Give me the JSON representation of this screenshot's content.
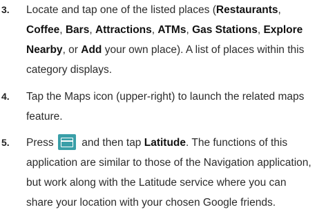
{
  "steps": [
    {
      "number": "3.",
      "lines": [
        [
          {
            "t": "Locate and tap one of the listed places (",
            "b": false
          },
          {
            "t": "Restaurants",
            "b": true
          },
          {
            "t": ",",
            "b": false
          }
        ],
        [
          {
            "t": "Coffee",
            "b": true
          },
          {
            "t": ", ",
            "b": false
          },
          {
            "t": "Bars",
            "b": true
          },
          {
            "t": ", ",
            "b": false
          },
          {
            "t": "Attractions",
            "b": true
          },
          {
            "t": ", ",
            "b": false
          },
          {
            "t": "ATMs",
            "b": true
          },
          {
            "t": ", ",
            "b": false
          },
          {
            "t": "Gas Stations",
            "b": true
          },
          {
            "t": ", ",
            "b": false
          },
          {
            "t": "Explore",
            "b": true
          }
        ],
        [
          {
            "t": "Nearby",
            "b": true
          },
          {
            "t": ", or ",
            "b": false
          },
          {
            "t": "Add",
            "b": true
          },
          {
            "t": " your own place). A list of places within this",
            "b": false
          }
        ],
        [
          {
            "t": "category displays.",
            "b": false
          }
        ]
      ]
    },
    {
      "number": "4.",
      "lines": [
        [
          {
            "t": "Tap the Maps icon (upper-right) to launch the related maps",
            "b": false
          }
        ],
        [
          {
            "t": "feature.",
            "b": false
          }
        ]
      ]
    },
    {
      "number": "5.",
      "lines": [
        [
          {
            "t": "Press ",
            "b": false
          },
          {
            "icon": "menu-key-icon"
          },
          {
            "t": " and then tap ",
            "b": false
          },
          {
            "t": "Latitude",
            "b": true
          },
          {
            "t": ". The functions of this",
            "b": false
          }
        ],
        [
          {
            "t": "application are similar to those of the Navigation application,",
            "b": false
          }
        ],
        [
          {
            "t": "but work along with the Latitude service where you can",
            "b": false
          }
        ],
        [
          {
            "t": "share your location with your chosen Google friends.",
            "b": false
          }
        ]
      ]
    }
  ],
  "colors": {
    "text": "#2b2b2b",
    "menu_icon_bg": "#3a9fa8",
    "menu_icon_fg": "#ffffff"
  }
}
